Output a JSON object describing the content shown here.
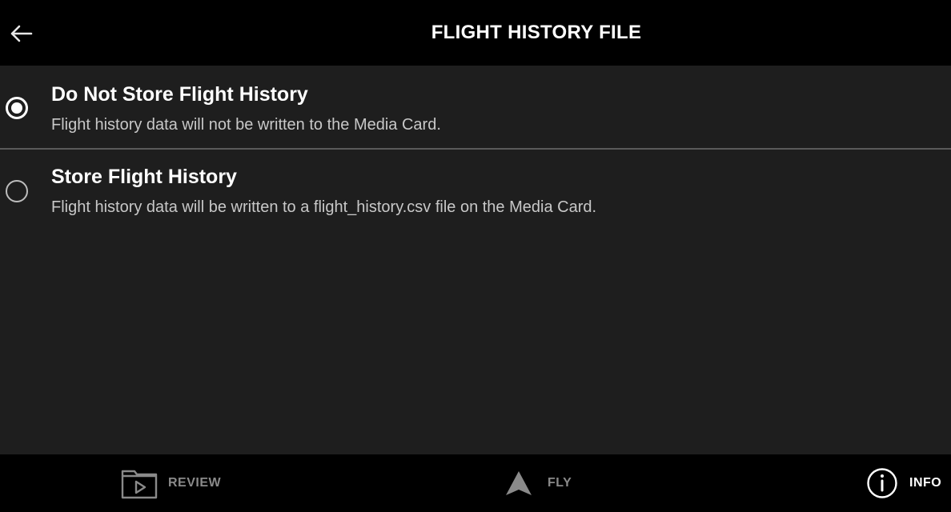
{
  "header": {
    "title": "FLIGHT HISTORY FILE",
    "back_icon": "arrow-left-icon"
  },
  "options": [
    {
      "title": "Do Not Store Flight History",
      "description": "Flight history data will not be written to the Media Card.",
      "selected": true
    },
    {
      "title": "Store Flight History",
      "description": "Flight history data will be written to a flight_history.csv file on the Media Card.",
      "selected": false
    }
  ],
  "bottom_nav": {
    "review": {
      "label": "REVIEW",
      "icon": "play-folder-icon"
    },
    "fly": {
      "label": "FLY",
      "icon": "navigation-arrow-icon"
    },
    "info": {
      "label": "INFO",
      "icon": "info-icon",
      "active": true
    }
  },
  "colors": {
    "background": "#000000",
    "panel": "#1e1e1e",
    "divider": "#5a5a5a",
    "text_primary": "#ffffff",
    "text_secondary": "#c8c8c8",
    "nav_inactive": "#8a8a8a"
  }
}
